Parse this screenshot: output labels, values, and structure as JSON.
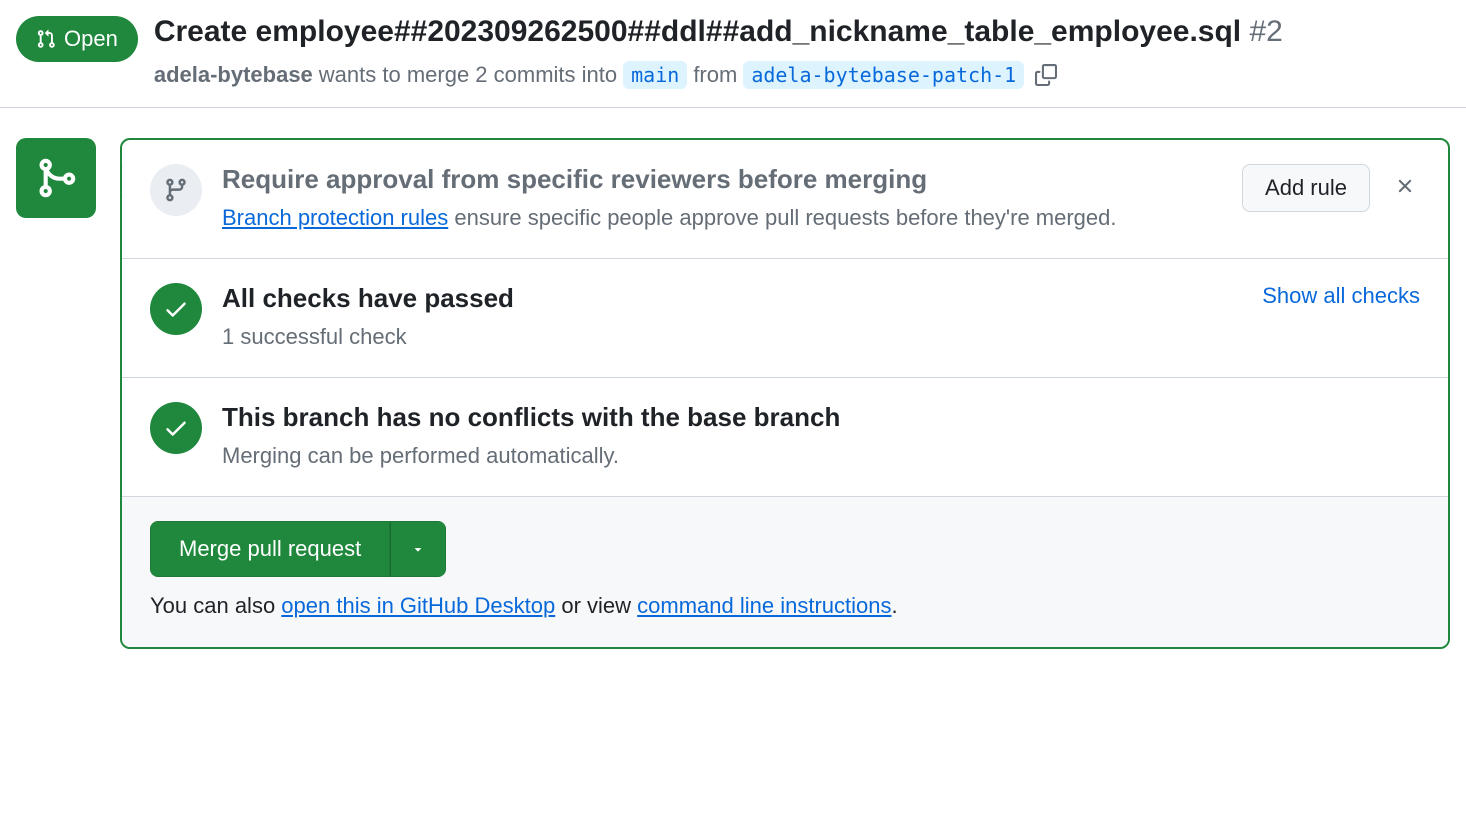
{
  "header": {
    "state": "Open",
    "title": "Create employee##202309262500##ddl##add_nickname_table_employee.sql",
    "pr_number": "#2",
    "author": "adela-bytebase",
    "wants_text": " wants to merge 2 commits into ",
    "base_branch": "main",
    "from_text": " from ",
    "head_branch": "adela-bytebase-patch-1"
  },
  "protection": {
    "title": "Require approval from specific reviewers before merging",
    "link_text": "Branch protection rules",
    "desc_rest": " ensure specific people approve pull requests before they're merged.",
    "add_rule": "Add rule"
  },
  "checks": {
    "title": "All checks have passed",
    "subtitle": "1 successful check",
    "show_all": "Show all checks"
  },
  "conflicts": {
    "title": "This branch has no conflicts with the base branch",
    "subtitle": "Merging can be performed automatically."
  },
  "footer": {
    "merge_button": "Merge pull request",
    "text_prefix": "You can also ",
    "desktop_link": "open this in GitHub Desktop",
    "text_mid": " or view ",
    "cli_link": "command line instructions",
    "text_suffix": "."
  }
}
